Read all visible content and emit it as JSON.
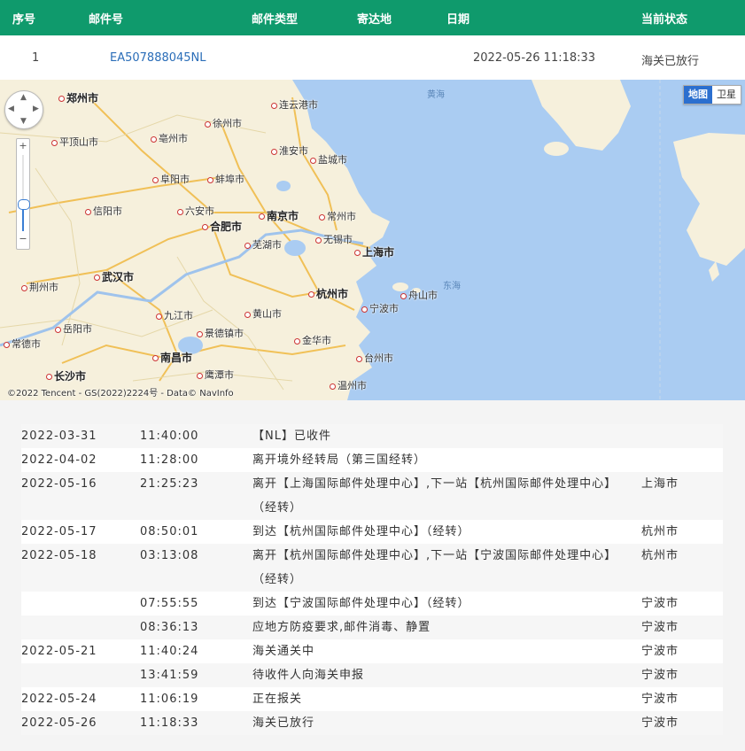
{
  "header": {
    "columns": [
      "序号",
      "邮件号",
      "邮件类型",
      "寄达地",
      "日期",
      "当前状态"
    ]
  },
  "summary": {
    "index": "1",
    "tracking_number": "EA507888045NL",
    "mail_type": "",
    "destination": "",
    "date": "2022-05-26 11:18:33",
    "status": "海关已放行"
  },
  "map": {
    "switch_map": "地图",
    "switch_satellite": "卫星",
    "copyright": "©2022 Tencent - GS(2022)2224号 - Data© NavInfo",
    "colors": {
      "land": "#f6f0dc",
      "sea": "#aaccf2",
      "road": "#f5c85a"
    },
    "cities": [
      {
        "name": "郑州市",
        "cls": "big"
      },
      {
        "name": "连云港市",
        "cls": ""
      },
      {
        "name": "徐州市",
        "cls": ""
      },
      {
        "name": "平顶山市",
        "cls": ""
      },
      {
        "name": "亳州市",
        "cls": ""
      },
      {
        "name": "淮安市",
        "cls": ""
      },
      {
        "name": "盐城市",
        "cls": ""
      },
      {
        "name": "阜阳市",
        "cls": ""
      },
      {
        "name": "蚌埠市",
        "cls": ""
      },
      {
        "name": "信阳市",
        "cls": ""
      },
      {
        "name": "六安市",
        "cls": ""
      },
      {
        "name": "南京市",
        "cls": "big"
      },
      {
        "name": "常州市",
        "cls": ""
      },
      {
        "name": "合肥市",
        "cls": "big"
      },
      {
        "name": "芜湖市",
        "cls": ""
      },
      {
        "name": "无锡市",
        "cls": ""
      },
      {
        "name": "上海市",
        "cls": "big"
      },
      {
        "name": "武汉市",
        "cls": "big"
      },
      {
        "name": "荆州市",
        "cls": ""
      },
      {
        "name": "杭州市",
        "cls": "big"
      },
      {
        "name": "舟山市",
        "cls": ""
      },
      {
        "name": "宁波市",
        "cls": ""
      },
      {
        "name": "九江市",
        "cls": ""
      },
      {
        "name": "黄山市",
        "cls": ""
      },
      {
        "name": "岳阳市",
        "cls": ""
      },
      {
        "name": "景德镇市",
        "cls": ""
      },
      {
        "name": "金华市",
        "cls": ""
      },
      {
        "name": "常德市",
        "cls": ""
      },
      {
        "name": "南昌市",
        "cls": "big"
      },
      {
        "name": "台州市",
        "cls": ""
      },
      {
        "name": "长沙市",
        "cls": "big"
      },
      {
        "name": "鹰潭市",
        "cls": ""
      },
      {
        "name": "温州市",
        "cls": ""
      },
      {
        "name": "黄海",
        "cls": "sea"
      },
      {
        "name": "东海",
        "cls": "sea"
      }
    ]
  },
  "events": [
    {
      "date": "2022-03-31",
      "time": "11:40:00",
      "desc": "【NL】已收件",
      "loc": "",
      "alt": true,
      "lines": 1
    },
    {
      "date": "2022-04-02",
      "time": "11:28:00",
      "desc": "离开境外经转局（第三国经转）",
      "loc": "",
      "alt": false,
      "lines": 1
    },
    {
      "date": "2022-05-16",
      "time": "21:25:23",
      "desc": "离开【上海国际邮件处理中心】,下一站【杭州国际邮件处理中心】（经转）",
      "loc": "上海市",
      "alt": true,
      "lines": 2
    },
    {
      "date": "2022-05-17",
      "time": "08:50:01",
      "desc": "到达【杭州国际邮件处理中心】（经转）",
      "loc": "杭州市",
      "alt": false,
      "lines": 1
    },
    {
      "date": "2022-05-18",
      "time": "03:13:08",
      "desc": "离开【杭州国际邮件处理中心】,下一站【宁波国际邮件处理中心】（经转）",
      "loc": "杭州市",
      "alt": true,
      "lines": 2
    },
    {
      "date": "",
      "time": "07:55:55",
      "desc": "到达【宁波国际邮件处理中心】（经转）",
      "loc": "宁波市",
      "alt": false,
      "lines": 1
    },
    {
      "date": "",
      "time": "08:36:13",
      "desc": "应地方防疫要求,邮件消毒、静置",
      "loc": "宁波市",
      "alt": true,
      "lines": 1
    },
    {
      "date": "2022-05-21",
      "time": "11:40:24",
      "desc": "海关通关中",
      "loc": "宁波市",
      "alt": false,
      "lines": 1
    },
    {
      "date": "",
      "time": "13:41:59",
      "desc": "待收件人向海关申报",
      "loc": "宁波市",
      "alt": true,
      "lines": 1
    },
    {
      "date": "2022-05-24",
      "time": "11:06:19",
      "desc": "正在报关",
      "loc": "宁波市",
      "alt": false,
      "lines": 1
    },
    {
      "date": "2022-05-26",
      "time": "11:18:33",
      "desc": "海关已放行",
      "loc": "宁波市",
      "alt": true,
      "lines": 1
    }
  ]
}
